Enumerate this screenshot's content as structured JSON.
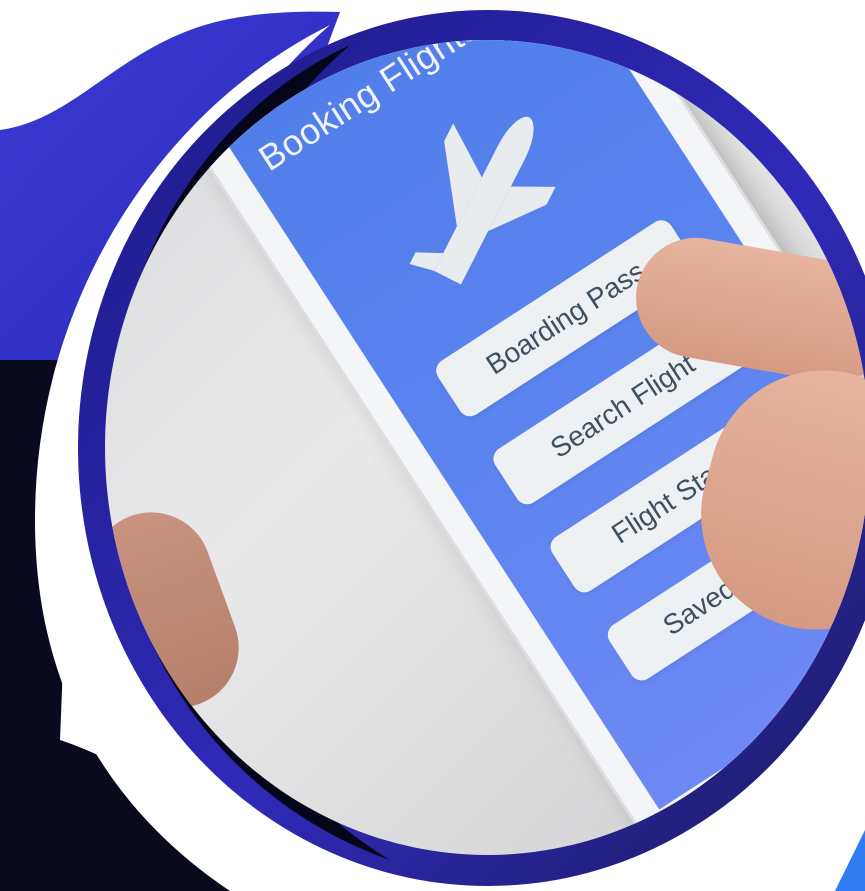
{
  "app": {
    "title": "Booking Flights",
    "menu_icon": "hamburger-menu-icon",
    "hero_icon": "airplane-icon"
  },
  "menu": {
    "items": [
      {
        "label": "Boarding Pass"
      },
      {
        "label": "Search Flight"
      },
      {
        "label": "Flight Status"
      },
      {
        "label": "Saved Flights"
      }
    ]
  },
  "colors": {
    "frame_blue": "#3a35c9",
    "frame_dark": "#0a0a1e",
    "screen_blue": "#5b84ef",
    "button_bg": "#eef1f3",
    "button_text": "#3f5160"
  }
}
